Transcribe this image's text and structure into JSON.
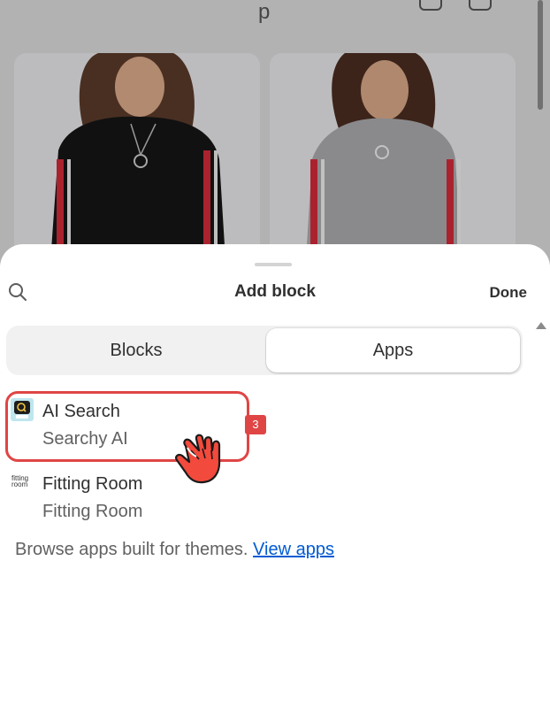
{
  "storefront": {
    "title_fragment": "p"
  },
  "sheet": {
    "title": "Add block",
    "done_label": "Done",
    "tabs": [
      {
        "label": "Blocks",
        "selected": false
      },
      {
        "label": "Apps",
        "selected": true
      }
    ],
    "apps": [
      {
        "name": "AI Search",
        "subtitle": "Searchy AI",
        "icon": "searchy-ai-logo"
      },
      {
        "name": "Fitting Room",
        "subtitle": "Fitting Room",
        "icon": "fitting-room-logo",
        "logo_text_1": "fitting",
        "logo_text_2": "room"
      }
    ],
    "browse_text": "Browse apps built for themes.",
    "browse_link": "View apps"
  },
  "annotation": {
    "step": "3",
    "color": "#e04545"
  },
  "colors": {
    "accent_link": "#005bd3",
    "text": "#303030",
    "subtext": "#616161"
  }
}
